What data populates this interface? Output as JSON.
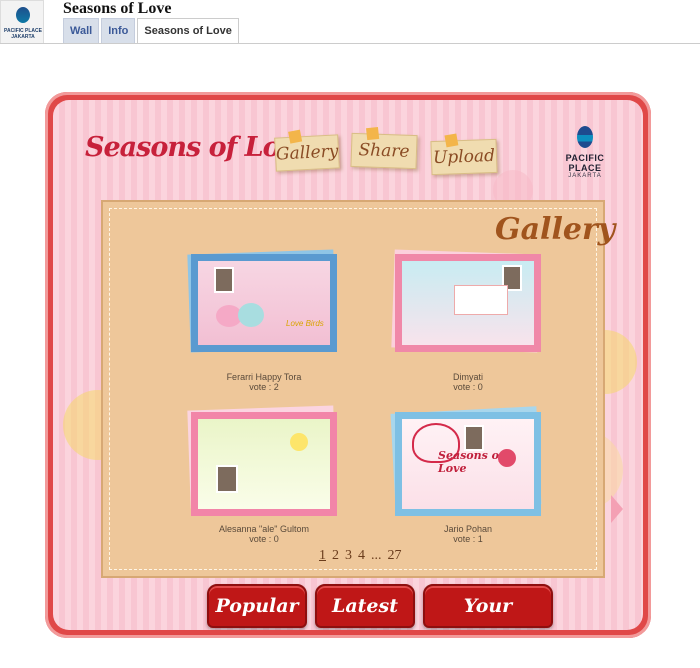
{
  "header": {
    "page_title": "Seasons of Love",
    "logo_text": "PACIFIC PLACE\nJAKARTA",
    "tabs": [
      {
        "label": "Wall"
      },
      {
        "label": "Info"
      },
      {
        "label": "Seasons of Love",
        "active": true
      }
    ]
  },
  "app": {
    "logo": "Seasons of Love",
    "nav": [
      {
        "label": "Gallery"
      },
      {
        "label": "Share"
      },
      {
        "label": "Upload"
      }
    ],
    "brand": {
      "name": "PACIFIC PLACE",
      "sub": "JAKARTA"
    },
    "gallery_title": "Gallery",
    "items": [
      {
        "name": "Ferarri Happy Tora",
        "vote": "vote : 2",
        "card_text": "Love Birds"
      },
      {
        "name": "Dimyati",
        "vote": "vote : 0"
      },
      {
        "name": "Alesanna \"ale\" Gultom",
        "vote": "vote : 0"
      },
      {
        "name": "Jario Pohan",
        "vote": "vote : 1",
        "card_text": "Seasons of Love"
      }
    ],
    "pagination": {
      "pages": [
        "1",
        "2",
        "3",
        "4",
        "...",
        "27"
      ],
      "current": "1"
    },
    "buttons": [
      {
        "label": "Popular"
      },
      {
        "label": "Latest"
      },
      {
        "label": "Your Upload"
      }
    ]
  },
  "colors": {
    "frame": "#e04848",
    "button": "#bf1717",
    "board": "#eec79a",
    "accent": "#c7213b"
  }
}
